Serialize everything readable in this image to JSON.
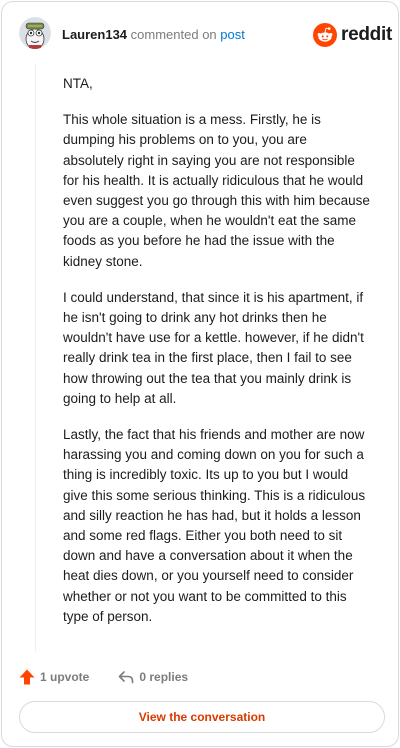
{
  "comment": {
    "username": "Lauren134",
    "action_text": "commented on",
    "post_link": "post",
    "paragraphs": [
      "NTA,",
      "This whole situation is a mess. Firstly, he is dumping his problems on to you, you are absolutely right in saying you are not responsible for his health. It is actually ridiculous that he would even suggest you go through this with him because you are a couple, when he wouldn't eat the same foods as you before he had the issue with the kidney stone.",
      "I could understand, that since it is his apartment, if he isn't going to drink any hot drinks then he wouldn't have use for a kettle. however, if he didn't really drink tea in the first place, then I fail to see how throwing out the tea that you mainly drink is going to help at all.",
      "Lastly, the fact that his friends and mother are now harassing you and coming down on you for such a thing is incredibly toxic. Its up to you but I would give this some serious thinking. This is a ridiculous and silly reaction he has had, but it holds a lesson and some red flags. Either you both need to sit down and have a conversation about it when the heat dies down, or you yourself need to consider whether or not you want to be committed to this type of person."
    ]
  },
  "brand": {
    "name": "reddit",
    "icon": "reddit-logo-icon",
    "color": "#ff4500"
  },
  "footer": {
    "upvote_label": "1 upvote",
    "upvote_icon": "upvote-arrow-icon",
    "upvote_color": "#ff4500",
    "replies_label": "0 replies",
    "replies_icon": "reply-icon"
  },
  "actions": {
    "view_conversation": "View the conversation",
    "accent": "#d93a00"
  }
}
